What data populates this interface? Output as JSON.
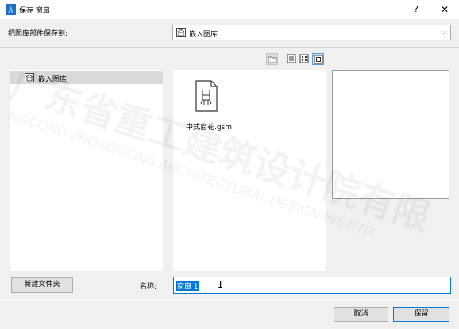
{
  "window": {
    "title": "保存 窗扇",
    "help_label": "?",
    "close_label": "✕"
  },
  "destination": {
    "label": "把图库部件保存到:",
    "selected": "嵌入图库",
    "chevron": "⌵"
  },
  "view_modes": [
    "folder-tree",
    "details-list",
    "small-icons",
    "large-icons"
  ],
  "active_view_mode": "large-icons",
  "tree": {
    "items": [
      {
        "label": "嵌入图库",
        "icon": "library-icon",
        "selected": true
      }
    ]
  },
  "files": [
    {
      "name": "中式窗花.gsm",
      "icon": "chair-file-icon"
    }
  ],
  "footer": {
    "new_folder_label": "新建文件夹",
    "name_label": "名称:",
    "name_value": "窗扇 1",
    "cancel_label": "取消",
    "save_label": "保留"
  },
  "colors": {
    "accent": "#0078d7",
    "selection": "#d9d9d9",
    "background": "#f0f0f0"
  }
}
